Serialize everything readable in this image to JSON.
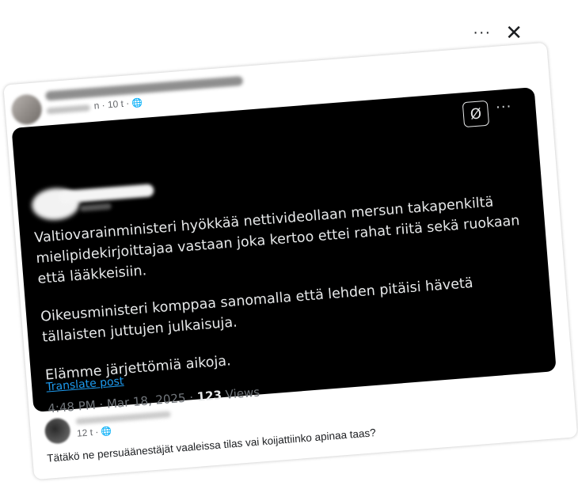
{
  "window": {
    "more_label": "···",
    "close_label": "✕"
  },
  "post": {
    "time": "n · 10 t ·",
    "globe_icon": "globe-icon"
  },
  "tweet": {
    "grok_label": "Ø",
    "more_label": "···",
    "paragraphs": [
      "Valtiovarainministeri hyökkää nettivideollaan mersun takapenkiltä mielipidekirjoittajaa vastaan joka kertoo ettei rahat riitä sekä ruokaan että lääkkeisiin.",
      "Oikeusministeri komppaa sanomalla että lehden pitäisi hävetä tällaisten juttujen julkaisuja.",
      "Elämme järjettömiä aikoja."
    ],
    "translate_label": "Translate post",
    "timestamp": "4:48 PM · Mar 18, 2025 · ",
    "views_count": "123",
    "views_label": " Views"
  },
  "comment": {
    "time": "12 t ·",
    "globe_icon": "globe-icon",
    "text": "Tätäkö ne persuäänestäjät vaaleissa tilas vai koijattiinko apinaa taas?"
  }
}
